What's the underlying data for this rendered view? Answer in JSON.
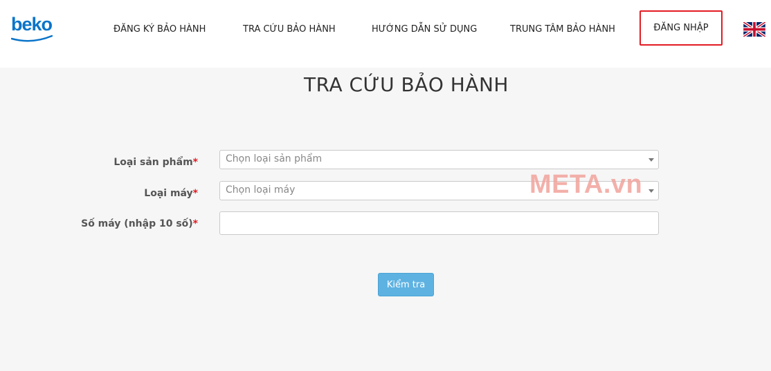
{
  "header": {
    "logo_text": "beko",
    "nav": [
      {
        "label": "ĐĂNG KÝ BẢO HÀNH"
      },
      {
        "label": "TRA CỨU BẢO HÀNH"
      },
      {
        "label": "HƯỚNG DẪN SỬ DỤNG"
      },
      {
        "label": "TRUNG TÂM BẢO HÀNH"
      }
    ],
    "login_label": "ĐĂNG NHẬP",
    "language_icon": "uk-flag-icon",
    "login_highlight_color": "#e21b23"
  },
  "main": {
    "title": "TRA CỨU BẢO HÀNH",
    "required_mark": "*",
    "fields": {
      "product_type": {
        "label": "Loại sản phẩm",
        "value": "Chọn loại sản phẩm"
      },
      "machine_type": {
        "label": "Loại máy",
        "value": "Chọn loại máy"
      },
      "serial": {
        "label": "Số máy (nhập 10 số)",
        "value": ""
      }
    },
    "submit_label": "Kiểm tra"
  },
  "watermark": "META.vn",
  "colors": {
    "brand": "#0a74c9",
    "button": "#5eb2e1",
    "required": "#e21b23"
  }
}
